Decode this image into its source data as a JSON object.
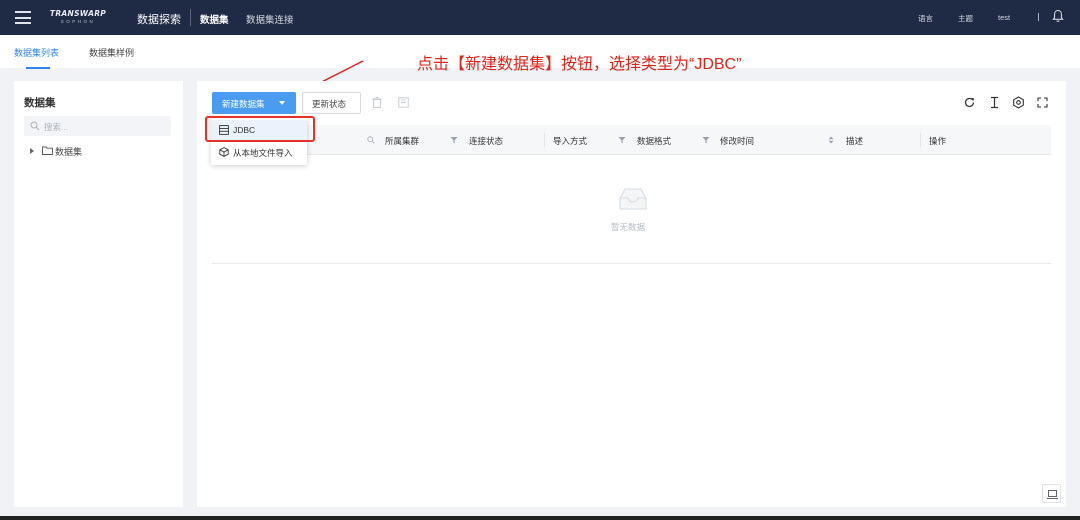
{
  "header": {
    "logo_line1": "TRANSWARP",
    "logo_line2": "SOPHON",
    "app_title": "数据探索",
    "nav": [
      "数据集",
      "数据集连接"
    ],
    "language": "语言",
    "theme": "主题",
    "user": "test",
    "icons": [
      "menu-icon",
      "bell-icon"
    ]
  },
  "tabs": [
    {
      "label": "数据集列表",
      "active": true
    },
    {
      "label": "数据集样例",
      "active": false
    }
  ],
  "annotation": {
    "text": "点击【新建数据集】按钮，选择类型为“JDBC”",
    "color": "#e2231a"
  },
  "left_panel": {
    "title": "数据集",
    "search_placeholder": "搜索...",
    "tree": [
      {
        "label": "数据集",
        "expanded": false
      }
    ]
  },
  "toolbar": {
    "new_dataset": "新建数据集",
    "refresh_status": "更新状态",
    "icons": [
      "delete-icon",
      "move-icon",
      "refresh-icon",
      "text-cursor-icon",
      "settings-icon",
      "fullscreen-icon"
    ]
  },
  "dropdown": {
    "items": [
      {
        "label": "JDBC",
        "icon": "table-icon",
        "highlighted": true
      },
      {
        "label": "从本地文件导入",
        "icon": "cube-icon",
        "highlighted": false
      }
    ]
  },
  "table": {
    "columns": [
      "所属集群",
      "连接状态",
      "导入方式",
      "数据格式",
      "修改时间",
      "描述",
      "操作"
    ],
    "rows": [],
    "empty_text": "暂无数据"
  },
  "colors": {
    "topbar": "#1f2a44",
    "accent": "#4a9cf0",
    "highlight_box": "#e5322a"
  }
}
